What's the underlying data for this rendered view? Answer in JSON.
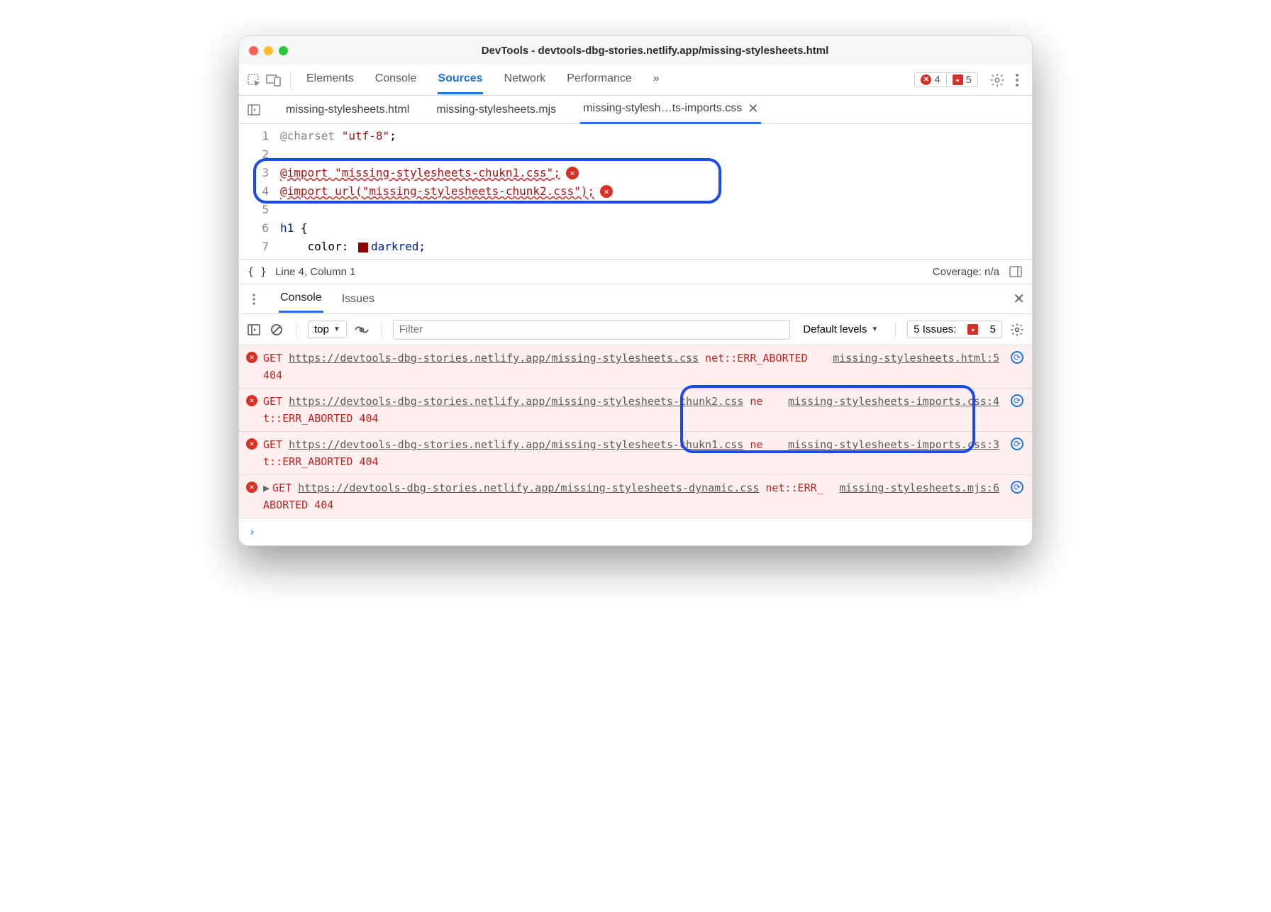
{
  "title": "DevTools - devtools-dbg-stories.netlify.app/missing-stylesheets.html",
  "panels": [
    "Elements",
    "Console",
    "Sources",
    "Network",
    "Performance"
  ],
  "active_panel": "Sources",
  "badge_errors": "4",
  "badge_issues": "5",
  "file_tabs": [
    "missing-stylesheets.html",
    "missing-stylesheets.mjs",
    "missing-stylesh…ts-imports.css"
  ],
  "active_file": 2,
  "editor": {
    "lines": [
      "@charset \"utf-8\";",
      "",
      "@import \"missing-stylesheets-chukn1.css\";",
      "@import url(\"missing-stylesheets-chunk2.css\");",
      "",
      "h1 {",
      "    color:  darkred;"
    ],
    "line_nums": [
      1,
      2,
      3,
      4,
      5,
      6,
      7
    ]
  },
  "status": {
    "pos": "Line 4, Column 1",
    "coverage": "Coverage: n/a"
  },
  "drawer_tabs": [
    "Console",
    "Issues"
  ],
  "console_bar": {
    "context": "top",
    "filter_placeholder": "Filter",
    "levels": "Default levels",
    "issues_label": "5 Issues:",
    "issues_count": "5"
  },
  "messages": [
    {
      "method": "GET",
      "url": "https://devtools-dbg-stories.netlify.app/missing-stylesheets.css",
      "err": "net::ERR_ABORTED 404",
      "src": "missing-stylesheets.html:5"
    },
    {
      "method": "GET",
      "url": "https://devtools-dbg-stories.netlify.app/missing-stylesheets-chunk2.css",
      "err": "net::ERR_ABORTED 404",
      "src": "missing-stylesheets-imports.css:4"
    },
    {
      "method": "GET",
      "url": "https://devtools-dbg-stories.netlify.app/missing-stylesheets-chukn1.css",
      "err": "net::ERR_ABORTED 404",
      "src": "missing-stylesheets-imports.css:3"
    },
    {
      "method": "GET",
      "url": "https://devtools-dbg-stories.netlify.app/missing-stylesheets-dynamic.css",
      "err": "net::ERR_ABORTED 404",
      "src": "missing-stylesheets.mjs:6",
      "expand": true
    }
  ]
}
